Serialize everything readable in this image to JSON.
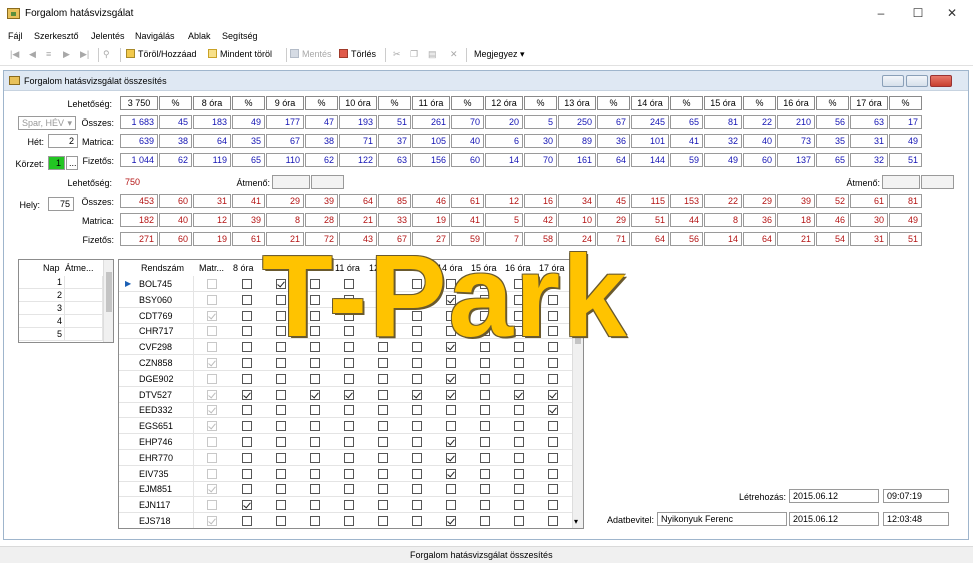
{
  "window": {
    "title": "Forgalom hatásvizsgálat"
  },
  "menu": [
    "Fájl",
    "Szerkesztő",
    "Jelentés",
    "Navigálás",
    "Ablak",
    "Segítség"
  ],
  "toolbar": {
    "toggle_label": "Töröl/Hozzáad",
    "delete_all_label": "Mindent töröl",
    "save_label": "Mentés",
    "delete_label": "Törlés",
    "note_label": "Megjegyez"
  },
  "child": {
    "title": "Forgalom hatásvizsgálat összesítés"
  },
  "filters": {
    "place_combo": "Spar, HÉV",
    "week_label": "Hét:",
    "week_value": "2",
    "district_label": "Körzet:",
    "district_value": "1",
    "hely_label": "Hely:",
    "hely_value": "75"
  },
  "summary": {
    "headers": [
      "3 750",
      "%",
      "8 óra",
      "%",
      "9 óra",
      "%",
      "10 óra",
      "%",
      "11 óra",
      "%",
      "12 óra",
      "%",
      "13 óra",
      "%",
      "14 óra",
      "%",
      "15 óra",
      "%",
      "16 óra",
      "%",
      "17 óra",
      "%"
    ],
    "row_labels": [
      "Lehetőség:",
      "Összes:",
      "Matrica:",
      "Fizetős:"
    ],
    "rows": [
      [
        "1 683",
        "45",
        "183",
        "49",
        "177",
        "47",
        "193",
        "51",
        "261",
        "70",
        "20",
        "5",
        "250",
        "67",
        "245",
        "65",
        "81",
        "22",
        "210",
        "56",
        "63",
        "17"
      ],
      [
        "639",
        "38",
        "64",
        "35",
        "67",
        "38",
        "71",
        "37",
        "105",
        "40",
        "6",
        "30",
        "89",
        "36",
        "101",
        "41",
        "32",
        "40",
        "73",
        "35",
        "31",
        "49"
      ],
      [
        "1 044",
        "62",
        "119",
        "65",
        "110",
        "62",
        "122",
        "63",
        "156",
        "60",
        "14",
        "70",
        "161",
        "64",
        "144",
        "59",
        "49",
        "60",
        "137",
        "65",
        "32",
        "51"
      ]
    ],
    "atmeno_label": "Átmenő:"
  },
  "place": {
    "row_labels": [
      "Lehetőség:",
      "Összes:",
      "Matrica:",
      "Fizetős:"
    ],
    "lehetoseg": "750",
    "rows": [
      [
        "453",
        "60",
        "31",
        "41",
        "29",
        "39",
        "64",
        "85",
        "46",
        "61",
        "12",
        "16",
        "34",
        "45",
        "115",
        "153",
        "22",
        "29",
        "39",
        "52",
        "61",
        "81"
      ],
      [
        "182",
        "40",
        "12",
        "39",
        "8",
        "28",
        "21",
        "33",
        "19",
        "41",
        "5",
        "42",
        "10",
        "29",
        "51",
        "44",
        "8",
        "36",
        "18",
        "46",
        "30",
        "49"
      ],
      [
        "271",
        "60",
        "19",
        "61",
        "21",
        "72",
        "43",
        "67",
        "27",
        "59",
        "7",
        "58",
        "24",
        "71",
        "64",
        "56",
        "14",
        "64",
        "21",
        "54",
        "31",
        "51"
      ]
    ]
  },
  "day_grid": {
    "headers": [
      "Nap",
      "Átme..."
    ],
    "rows": [
      "1",
      "2",
      "3",
      "4",
      "5"
    ]
  },
  "plate_grid": {
    "headers": [
      "Rendszám",
      "Matr...",
      "8 óra",
      "9 óra",
      "10 óra",
      "11 óra",
      "12 óra",
      "13 óra",
      "14 óra",
      "15 óra",
      "16 óra",
      "17 óra"
    ],
    "rows": [
      {
        "plate": "BOL745",
        "m": 0,
        "h": [
          0,
          1,
          0,
          0,
          1,
          0,
          0,
          0,
          0,
          0
        ]
      },
      {
        "plate": "BSY060",
        "m": 0,
        "h": [
          0,
          0,
          0,
          0,
          0,
          0,
          1,
          0,
          0,
          0
        ]
      },
      {
        "plate": "CDT769",
        "m": 1,
        "h": [
          0,
          0,
          0,
          0,
          0,
          0,
          0,
          0,
          0,
          0
        ]
      },
      {
        "plate": "CHR717",
        "m": 0,
        "h": [
          0,
          0,
          0,
          0,
          0,
          0,
          0,
          0,
          0,
          0
        ]
      },
      {
        "plate": "CVF298",
        "m": 0,
        "h": [
          0,
          0,
          0,
          0,
          0,
          0,
          1,
          0,
          0,
          0
        ]
      },
      {
        "plate": "CZN858",
        "m": 1,
        "h": [
          0,
          0,
          0,
          0,
          0,
          0,
          0,
          0,
          0,
          0
        ]
      },
      {
        "plate": "DGE902",
        "m": 0,
        "h": [
          0,
          0,
          0,
          0,
          0,
          0,
          1,
          0,
          0,
          0
        ]
      },
      {
        "plate": "DTV527",
        "m": 1,
        "h": [
          1,
          0,
          1,
          1,
          0,
          1,
          1,
          0,
          1,
          1
        ]
      },
      {
        "plate": "EED332",
        "m": 1,
        "h": [
          0,
          0,
          0,
          0,
          0,
          0,
          0,
          0,
          0,
          1
        ]
      },
      {
        "plate": "EGS651",
        "m": 1,
        "h": [
          0,
          0,
          0,
          0,
          0,
          0,
          0,
          0,
          0,
          0
        ]
      },
      {
        "plate": "EHP746",
        "m": 0,
        "h": [
          0,
          0,
          0,
          0,
          0,
          0,
          1,
          0,
          0,
          0
        ]
      },
      {
        "plate": "EHR770",
        "m": 0,
        "h": [
          0,
          0,
          0,
          0,
          0,
          0,
          1,
          0,
          0,
          0
        ]
      },
      {
        "plate": "EIV735",
        "m": 0,
        "h": [
          0,
          0,
          0,
          0,
          0,
          0,
          1,
          0,
          0,
          0
        ]
      },
      {
        "plate": "EJM851",
        "m": 1,
        "h": [
          0,
          0,
          0,
          0,
          0,
          0,
          0,
          0,
          0,
          0
        ]
      },
      {
        "plate": "EJN117",
        "m": 0,
        "h": [
          1,
          0,
          0,
          0,
          0,
          0,
          0,
          0,
          0,
          0
        ]
      },
      {
        "plate": "EJS718",
        "m": 1,
        "h": [
          0,
          0,
          0,
          0,
          0,
          0,
          1,
          0,
          0,
          0
        ]
      }
    ]
  },
  "audit": {
    "created_label": "Létrehozás:",
    "created_date": "2015.06.12",
    "created_time": "09:07:19",
    "modified_label": "Adatbevitel:",
    "modified_user": "Nyikonyuk Ferenc",
    "modified_date": "2015.06.12",
    "modified_time": "12:03:48"
  },
  "status": {
    "text": "Forgalom hatásvizsgálat összesítés"
  },
  "watermark": "T-Park",
  "colors": {
    "blue_values": "#1414b4",
    "red_values": "#b41414",
    "district_highlight": "#22c522",
    "watermark": "#ffc300"
  }
}
